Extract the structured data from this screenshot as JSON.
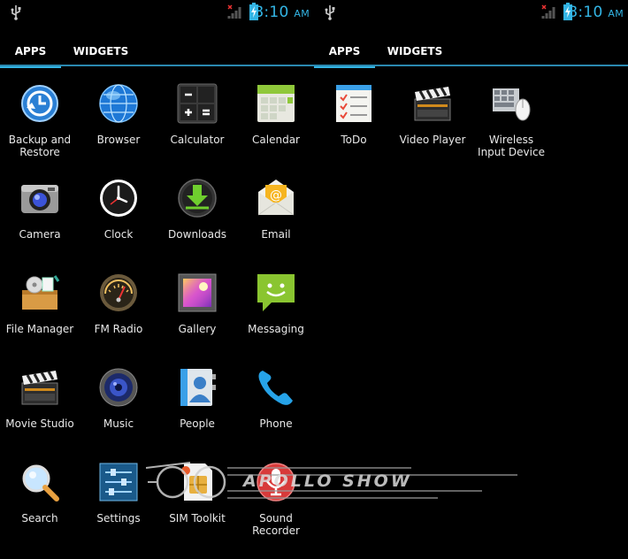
{
  "status_bar": {
    "time": "8:10",
    "ampm": "AM"
  },
  "tabs": [
    {
      "label": "APPS",
      "selected": true
    },
    {
      "label": "WIDGETS",
      "selected": false
    }
  ],
  "accent_color": "#33b5e5",
  "pages": [
    {
      "apps": [
        {
          "label": "Backup and\nRestore",
          "icon": "backup-restore-icon"
        },
        {
          "label": "Browser",
          "icon": "globe-icon"
        },
        {
          "label": "Calculator",
          "icon": "calculator-icon"
        },
        {
          "label": "Calendar",
          "icon": "calendar-icon"
        },
        {
          "label": "Camera",
          "icon": "camera-icon"
        },
        {
          "label": "Clock",
          "icon": "clock-icon"
        },
        {
          "label": "Downloads",
          "icon": "download-icon"
        },
        {
          "label": "Email",
          "icon": "envelope-icon"
        },
        {
          "label": "File Manager",
          "icon": "file-box-icon"
        },
        {
          "label": "FM Radio",
          "icon": "radio-dial-icon"
        },
        {
          "label": "Gallery",
          "icon": "photo-frame-icon"
        },
        {
          "label": "Messaging",
          "icon": "chat-bubble-icon"
        },
        {
          "label": "Movie Studio",
          "icon": "clapperboard-icon"
        },
        {
          "label": "Music",
          "icon": "speaker-icon"
        },
        {
          "label": "People",
          "icon": "contact-card-icon"
        },
        {
          "label": "Phone",
          "icon": "phone-handset-icon"
        },
        {
          "label": "Search",
          "icon": "magnifier-icon"
        },
        {
          "label": "Settings",
          "icon": "sliders-icon"
        },
        {
          "label": "SIM Toolkit",
          "icon": "sim-card-icon"
        },
        {
          "label": "Sound\nRecorder",
          "icon": "microphone-icon"
        }
      ]
    },
    {
      "apps": [
        {
          "label": "ToDo",
          "icon": "checklist-icon"
        },
        {
          "label": "Video Player",
          "icon": "clapperboard-icon"
        },
        {
          "label": "Wireless\nInput Device",
          "icon": "keyboard-mouse-icon"
        }
      ]
    }
  ],
  "watermark": {
    "text": "APOLLO SHOW"
  }
}
